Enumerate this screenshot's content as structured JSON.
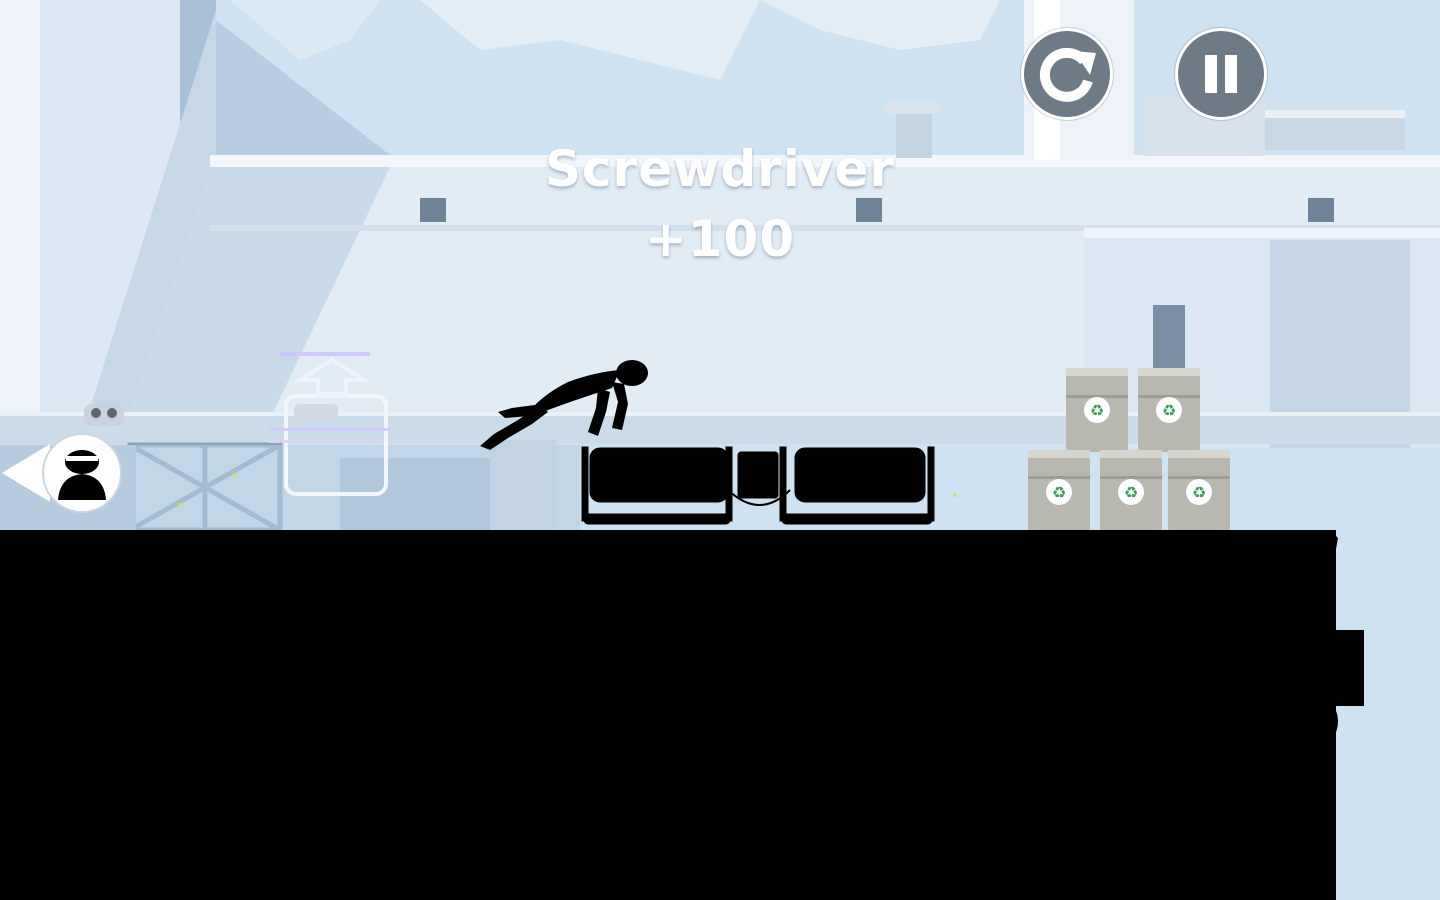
{
  "hud": {
    "restart_icon": "restart-icon",
    "pause_icon": "pause-icon",
    "button_color": "#6e7a86"
  },
  "pickup": {
    "name": "Screwdriver",
    "score": "+100"
  },
  "hunter_indicator": {
    "icon": "hunter-head-icon"
  },
  "colors": {
    "sky": "#cfe2f1",
    "building": "#e6eff7",
    "silhouette": "#000000",
    "barrel": "#b9b8b0",
    "recycle": "#3a9e58"
  }
}
